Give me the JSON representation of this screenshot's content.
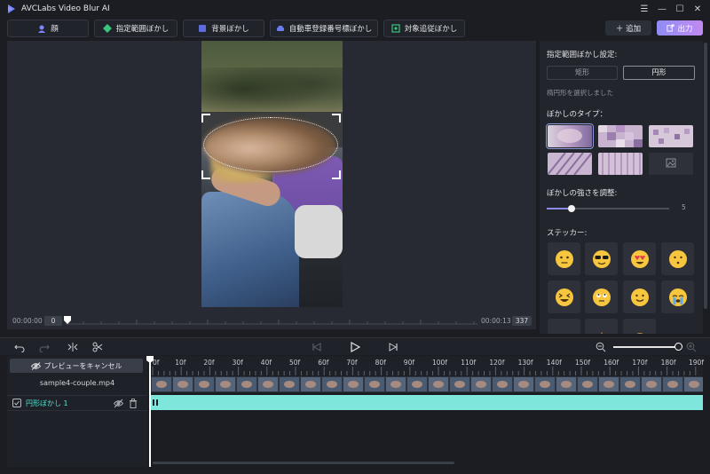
{
  "app": {
    "title": "AVCLabs Video Blur AI",
    "colors": {
      "accent": "#8c8ae8",
      "teal": "#5be0d2",
      "export_gradient_start": "#8e8cf5",
      "export_gradient_end": "#c38af0"
    }
  },
  "window_controls": {
    "menu": "☰",
    "minimize": "—",
    "maximize": "☐",
    "close": "✕"
  },
  "toolbar": {
    "tools": [
      {
        "label": "顔",
        "icon": "face-icon"
      },
      {
        "label": "指定範囲ぼかし",
        "icon": "region-icon"
      },
      {
        "label": "背景ぼかし",
        "icon": "background-icon"
      },
      {
        "label": "自動車登録番号標ぼかし",
        "icon": "car-icon"
      },
      {
        "label": "対象追従ぼかし",
        "icon": "tracking-icon"
      }
    ],
    "add_label": "＋ 追加",
    "export_label": "出力"
  },
  "preview": {
    "time_start": "00:00:00",
    "frame_start": "0",
    "time_end": "00:00:13",
    "frame_end": "337"
  },
  "panel": {
    "region_title": "指定範囲ぼかし設定:",
    "shape_rect": "矩形",
    "shape_circle": "円形",
    "shape_selected": "円形",
    "shape_hint": "楕円形を選択しました",
    "blur_type_title": "ぼかしのタイプ：",
    "strength_title": "ぼかしの強さを調整:",
    "strength_value": "5",
    "strength_fraction": 0.2,
    "sticker_title": "ステッカー:",
    "stickers": [
      "neutral-face",
      "sunglasses-face",
      "heart-eyes-face",
      "hushed-face",
      "squinting-face",
      "rolling-eyes-face",
      "smiling-face",
      "crying-face"
    ]
  },
  "timeline": {
    "cancel_preview_label": "プレビューをキャンセル",
    "file_name": "sample4-couple.mp4",
    "blur_track_label": "円形ぼかし 1",
    "ticks": [
      "0f",
      "10f",
      "20f",
      "30f",
      "40f",
      "50f",
      "60f",
      "70f",
      "80f",
      "90f",
      "100f",
      "110f",
      "120f",
      "130f",
      "140f",
      "150f",
      "160f",
      "170f",
      "180f",
      "190f"
    ]
  }
}
